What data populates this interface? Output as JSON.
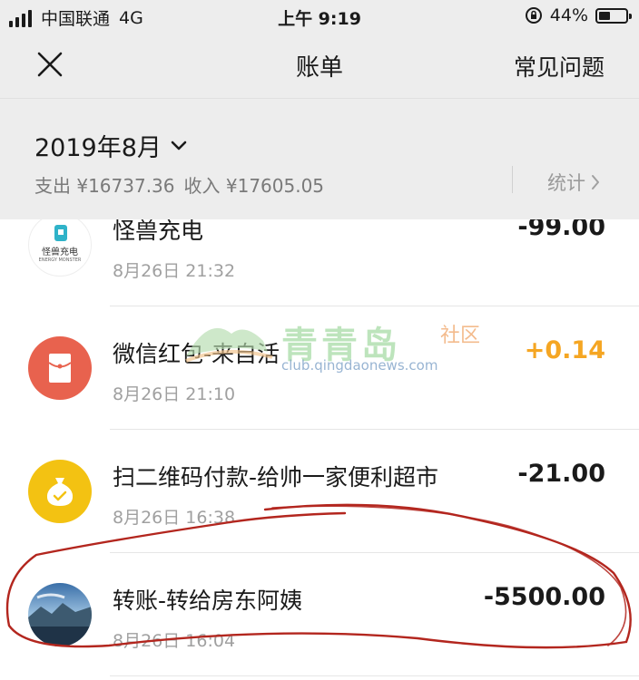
{
  "status_bar": {
    "carrier": "中国联通",
    "network": "4G",
    "time": "上午 9:19",
    "battery": "44%"
  },
  "nav": {
    "title": "账单",
    "faq": "常见问题"
  },
  "month_header": {
    "month": "2019年8月",
    "expense": "支出 ¥16737.36",
    "income": "收入 ¥17605.05",
    "stats": "统计"
  },
  "transactions": [
    {
      "name": "怪兽充电",
      "time": "8月26日 21:32",
      "amount": "-99.00",
      "icon": "energy-monster-logo",
      "logo_text": "怪兽充电",
      "logo_subtext": "ENERGY MONSTER"
    },
    {
      "name": "微信红包-来自活",
      "time": "8月26日 21:10",
      "amount": "+0.14",
      "icon": "red-packet-icon"
    },
    {
      "name": "扫二维码付款-给帅一家便利超市",
      "time": "8月26日 16:38",
      "amount": "-21.00",
      "icon": "money-bag-icon"
    },
    {
      "name": "转账-转给房东阿姨",
      "time": "8月26日 16:04",
      "amount": "-5500.00",
      "icon": "avatar-landscape"
    }
  ],
  "watermark": {
    "brand": "青青岛",
    "sub": "社区",
    "url": "club.qingdaonews.com"
  },
  "colors": {
    "positive_amount": "#f5a623",
    "red_packet": "#e8624e",
    "money_bag": "#f3c212",
    "annotation": "#b3261e"
  }
}
